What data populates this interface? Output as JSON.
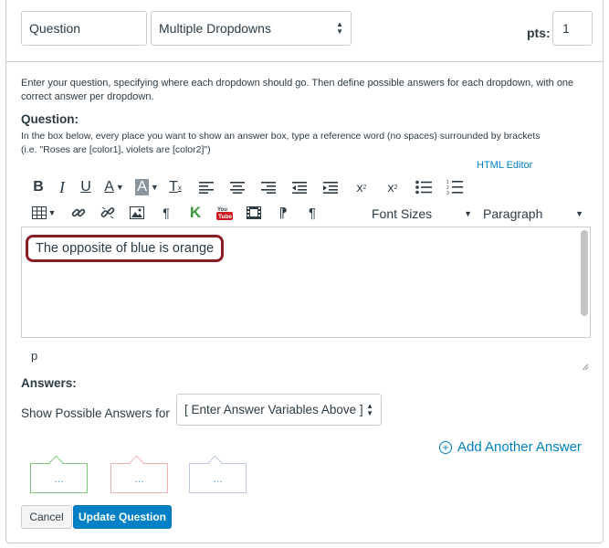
{
  "header": {
    "title_value": "Question",
    "type_value": "Multiple Dropdowns",
    "pts_label": "pts:",
    "pts_value": "1"
  },
  "instructions": "Enter your question, specifying where each dropdown should go. Then define possible answers for each dropdown, with one correct answer per dropdown.",
  "question": {
    "label": "Question:",
    "help_line1": "In the box below, every place you want to show an answer box, type a reference word (no spaces) surrounded by brackets",
    "help_line2": "(i.e. \"Roses are [color1], violets are [color2]\")",
    "html_editor_link": "HTML Editor"
  },
  "toolbar": {
    "font_sizes": "Font Sizes",
    "paragraph": "Paragraph"
  },
  "editor": {
    "content": "The opposite of blue is orange",
    "path": "p"
  },
  "answers": {
    "label": "Answers:",
    "show_label": "Show Possible Answers for",
    "select_value": "[ Enter Answer Variables Above ]",
    "add_link": "Add Another Answer",
    "bubbles": [
      "...",
      "...",
      "..."
    ]
  },
  "buttons": {
    "cancel": "Cancel",
    "update": "Update Question"
  },
  "colors": {
    "accent": "#0081c6",
    "highlight_border": "#8a1d26",
    "bubble_green": "#7cc57a",
    "bubble_red": "#f4b1b1",
    "bubble_blue": "#bcc8e6"
  }
}
